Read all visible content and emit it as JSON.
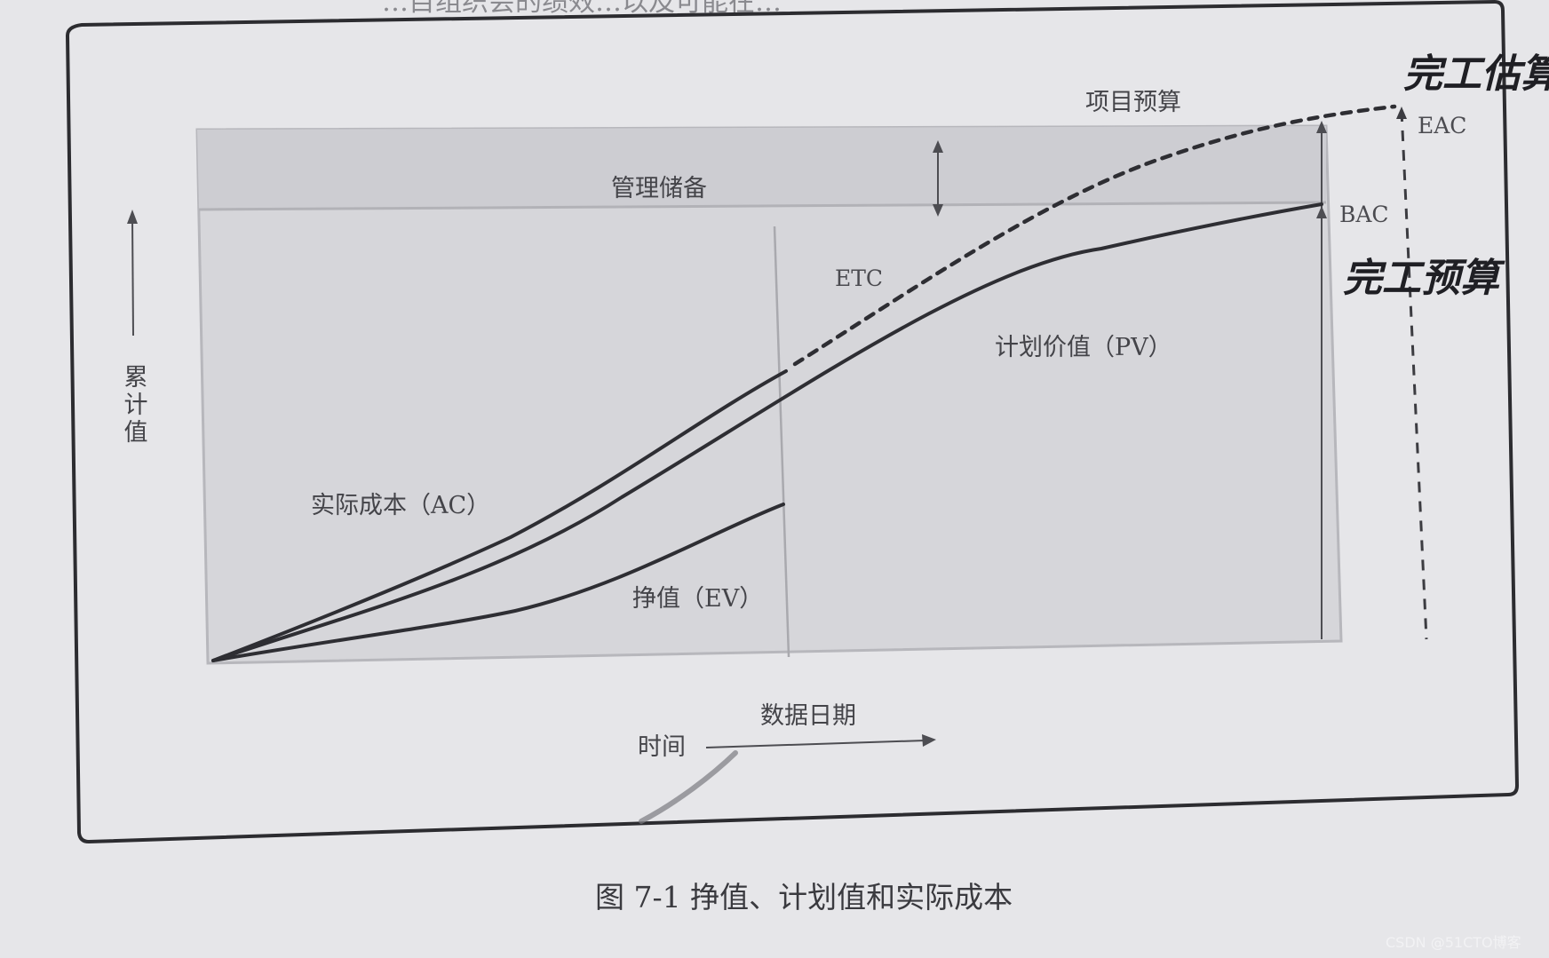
{
  "top_partial_text": "…目组织会的绩效…以及可能在…",
  "labels": {
    "project_budget": "项目预算",
    "management_reserve": "管理储备",
    "etc": "ETC",
    "eac": "EAC",
    "bac": "BAC",
    "pv": "计划价值（PV）",
    "ac": "实际成本（AC）",
    "ev": "挣值（EV）",
    "y_axis": "累计值",
    "x_axis": "时间",
    "data_date": "数据日期"
  },
  "handwritten": {
    "eac_note": "完工估算",
    "bac_note": "完工预算"
  },
  "caption": "图 7-1    挣值、计划值和实际成本",
  "watermark": "CSDN @51CTO博客",
  "colors": {
    "paper": "#e6e6e9",
    "panel": "#d6d6da",
    "reserve_band": "#cdcdd2",
    "ink": "#2e2e33"
  }
}
